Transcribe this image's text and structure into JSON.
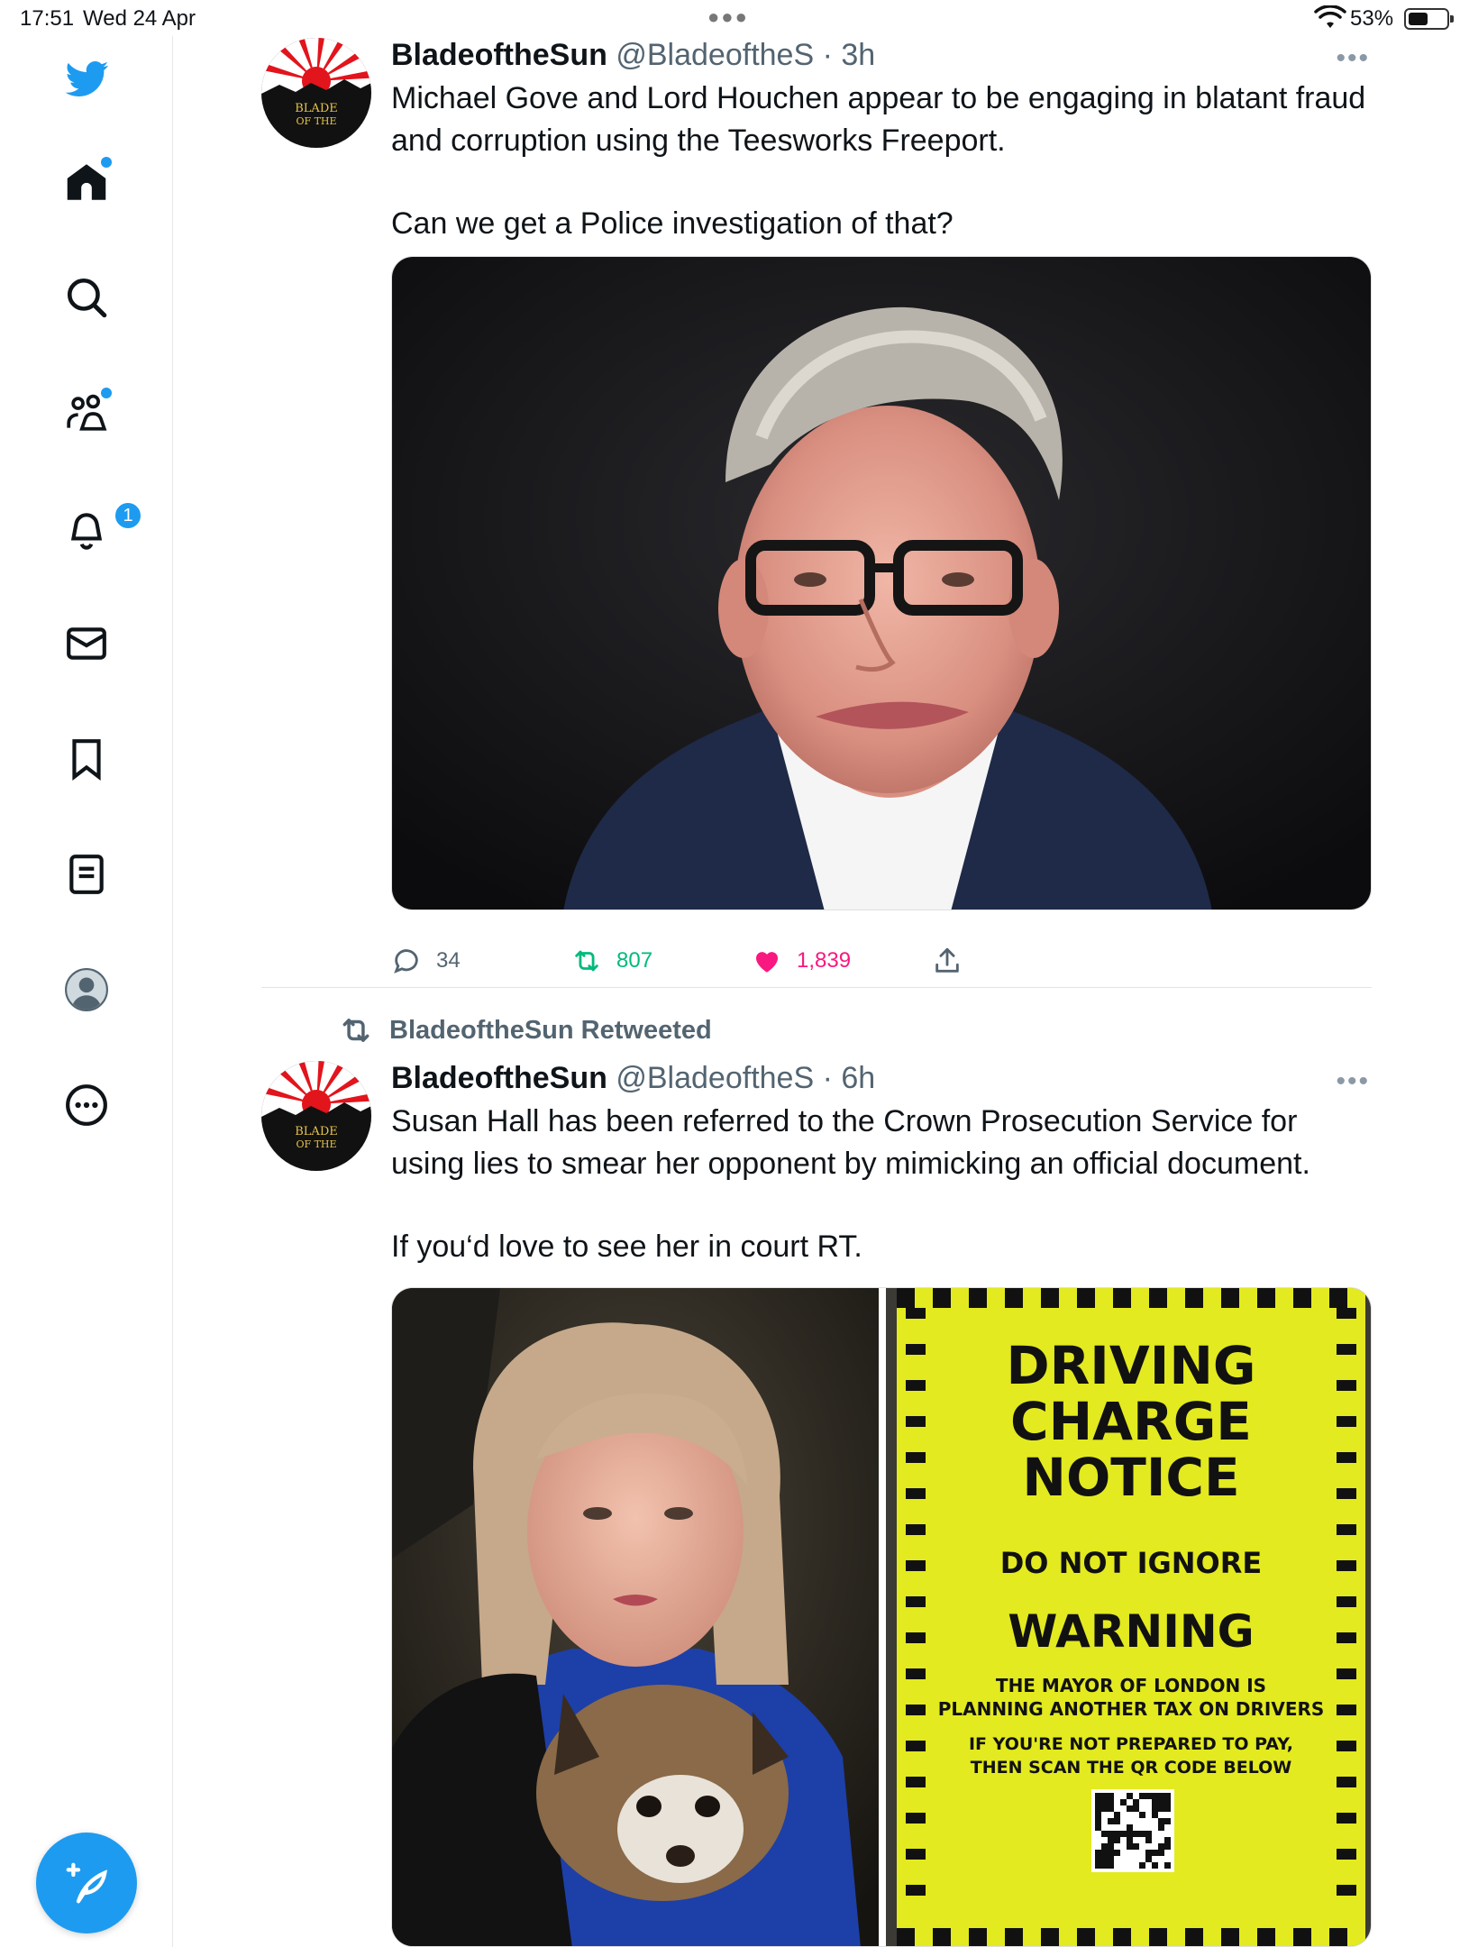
{
  "status_bar": {
    "time": "17:51",
    "date": "Wed 24 Apr",
    "battery": "53%",
    "battery_level": 0.53
  },
  "sidebar": {
    "items": [
      {
        "icon": "twitter-bird-icon"
      },
      {
        "icon": "home-icon",
        "has_dot": true
      },
      {
        "icon": "search-icon"
      },
      {
        "icon": "communities-icon",
        "has_dot": true
      },
      {
        "icon": "notifications-bell-icon",
        "badge": "1"
      },
      {
        "icon": "messages-envelope-icon"
      },
      {
        "icon": "bookmarks-icon"
      },
      {
        "icon": "lists-icon"
      },
      {
        "icon": "profile-avatar-icon"
      },
      {
        "icon": "more-options-icon"
      }
    ],
    "compose_icon": "compose-feather-icon"
  },
  "tweets": [
    {
      "display_name": "BladeoftheSun",
      "handle": "@BladeoftheS",
      "time": "· 3h",
      "text_lines": [
        "Michael Gove and Lord Houchen appear to be engaging in blatant fraud",
        "and corruption using the Teesworks Freeport."
      ],
      "text_followup": "Can we get a Police investigation of that?",
      "replies": "34",
      "retweets": "807",
      "likes": "1,839"
    },
    {
      "retweet_label": "BladeoftheSun Retweeted",
      "display_name": "BladeoftheSun",
      "handle": "@BladeoftheS",
      "time": "· 6h",
      "text_lines": [
        "Susan Hall has been referred to the Crown Prosecution Service for",
        "using lies to smear her opponent by mimicking an official document."
      ],
      "text_followup": "If you‘d love to see her in court RT.",
      "notice": {
        "line1": "DRIVING",
        "line2": "CHARGE",
        "line3": "NOTICE",
        "line4": "DO NOT IGNORE",
        "line5": "WARNING",
        "line6": "THE MAYOR OF LONDON IS",
        "line7": "PLANNING ANOTHER TAX ON DRIVERS",
        "line8": "IF YOU'RE NOT PREPARED TO PAY,",
        "line9": "THEN SCAN THE QR CODE BELOW"
      }
    }
  ],
  "avatar_logo": {
    "line1": "BLADE",
    "line2": "OF THE"
  },
  "colors": {
    "accent": "#1d9bf0",
    "retweet": "#00ba7c",
    "like": "#f91880",
    "notice_yellow": "#e3ea1f"
  }
}
